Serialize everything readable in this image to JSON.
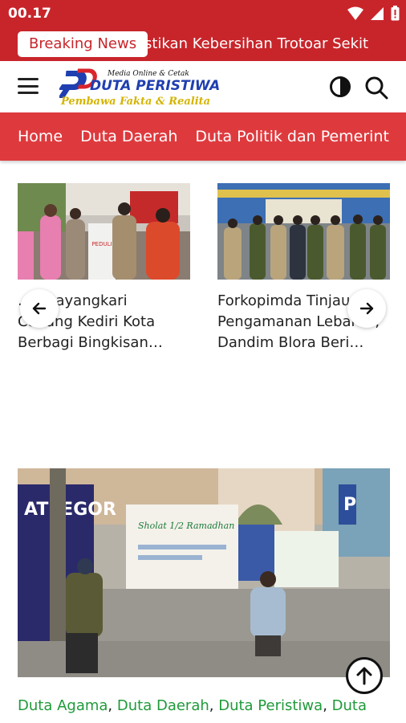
{
  "status_bar": {
    "time": "00.17"
  },
  "breaking": {
    "label": "Breaking News",
    "ticker_text": "stikan Kebersihan Trotoar Sekit"
  },
  "header": {
    "logo": {
      "tagline_top": "Media Online & Cetak",
      "brand": "DUTA PERISTIWA",
      "slogan": "Pembawa Fakta & Realita"
    }
  },
  "nav": {
    "items": [
      {
        "label": "Home"
      },
      {
        "label": "Duta Daerah"
      },
      {
        "label": "Duta Politik dan Pemerint"
      }
    ]
  },
  "carousel": {
    "cards": [
      {
        "title": "Bhayangkari Cabang Kediri Kota Berbagi Bingkisan…",
        "title_visible": "…  Bhayangkari\nCabang Kediri Kota\nBerbagi Bingkisan…",
        "banner_text": "PEDULI"
      },
      {
        "title": "Forkopimda Tinjau Pengamanan Lebaran, Dandim Blora Beri…"
      }
    ]
  },
  "featured": {
    "banner_text": "Sholat 1/2 Ramadhan",
    "side_banner_text": "ATI EGOR"
  },
  "categories": {
    "items": [
      "Duta Agama",
      "Duta Daerah",
      "Duta Peristiwa",
      "Duta"
    ]
  },
  "colors": {
    "primary_red": "#c8252b",
    "nav_red": "#de3a3e",
    "category_green": "#1f9a3a"
  },
  "icons": {
    "status": [
      "wifi-icon",
      "cellular-signal-icon",
      "battery-icon"
    ],
    "header": [
      "hamburger-menu-icon",
      "theme-toggle-icon",
      "search-icon"
    ],
    "carousel": [
      "arrow-left-icon",
      "arrow-right-icon"
    ],
    "scroll": "arrow-up-icon"
  }
}
